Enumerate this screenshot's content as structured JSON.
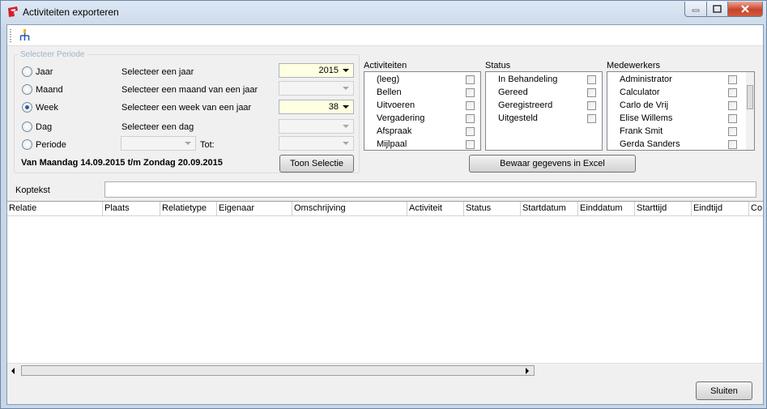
{
  "window": {
    "title": "Activiteiten exporteren",
    "colors": {
      "accent": "#2c5c97",
      "highlight_input": "#ffffe1",
      "legend": "#9fb3c9"
    }
  },
  "period": {
    "legend": "Selecteer Periode",
    "options": [
      {
        "label": "Jaar",
        "prompt": "Selecteer een jaar",
        "selected": false,
        "value": "2015"
      },
      {
        "label": "Maand",
        "prompt": "Selecteer een maand van een jaar",
        "selected": false,
        "value": ""
      },
      {
        "label": "Week",
        "prompt": "Selecteer een week van een jaar",
        "selected": true,
        "value": "38"
      },
      {
        "label": "Dag",
        "prompt": "Selecteer een dag",
        "selected": false,
        "value": ""
      },
      {
        "label": "Periode",
        "prompt": "",
        "selected": false,
        "value": ""
      }
    ],
    "tot_label": "Tot:",
    "summary": "Van Maandag 14.09.2015 t/m Zondag 20.09.2015",
    "show_button": "Toon Selectie"
  },
  "activiteiten": {
    "title": "Activiteiten",
    "items": [
      "(leeg)",
      "Bellen",
      "Uitvoeren",
      "Vergadering",
      "Afspraak",
      "Mijlpaal"
    ]
  },
  "status": {
    "title": "Status",
    "items": [
      "In Behandeling",
      "Gereed",
      "Geregistreerd",
      "Uitgesteld"
    ]
  },
  "medewerkers": {
    "title": "Medewerkers",
    "items": [
      "Administrator",
      "Calculator",
      "Carlo de Vrij",
      "Elise Willems",
      "Frank Smit",
      "Gerda Sanders"
    ]
  },
  "excel_button": "Bewaar gegevens in Excel",
  "koptekst": {
    "label": "Koptekst",
    "value": ""
  },
  "grid": {
    "columns": [
      "Relatie",
      "Plaats",
      "Relatietype",
      "Eigenaar",
      "Omschrijving",
      "Activiteit",
      "Status",
      "Startdatum",
      "Einddatum",
      "Starttijd",
      "Eindtijd",
      "Co"
    ]
  },
  "close_button": "Sluiten"
}
